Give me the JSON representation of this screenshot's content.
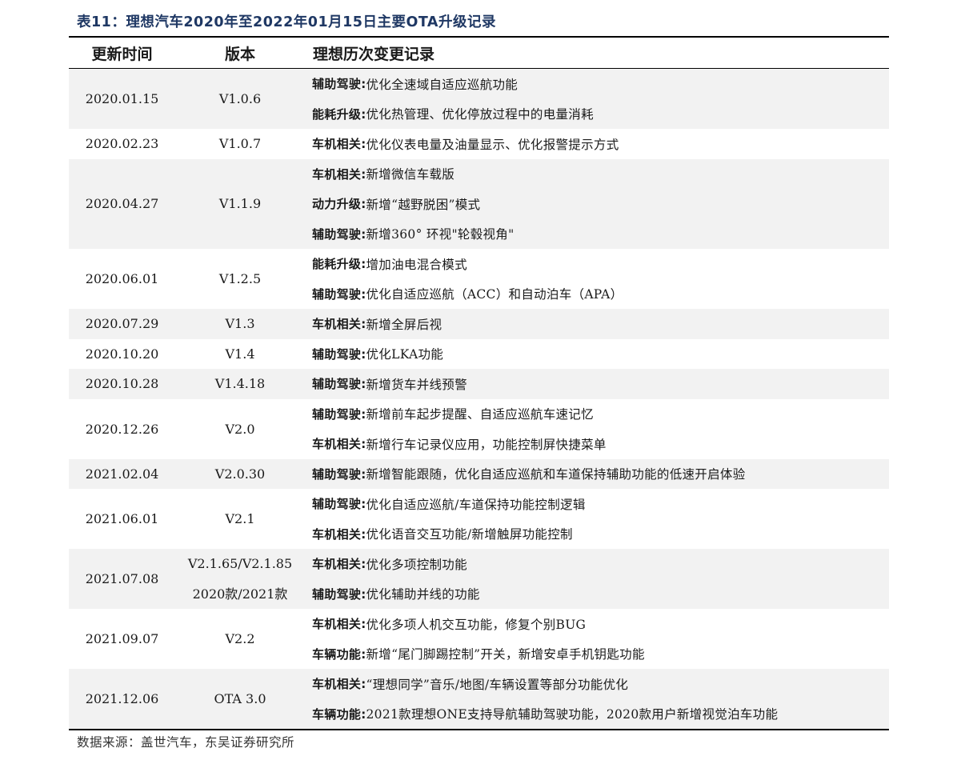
{
  "title": "表11：理想汽车2020年至2022年01月15日主要OTA升级记录",
  "headers": {
    "date": "更新时间",
    "version": "版本",
    "log": "理想历次变更记录"
  },
  "rows": [
    {
      "date": "2020.01.15",
      "version": [
        "V1.0.6"
      ],
      "entries": [
        {
          "cat": "辅助驾驶:",
          "text": "优化全速域自适应巡航功能"
        },
        {
          "cat": "能耗升级:",
          "text": "优化热管理、优化停放过程中的电量消耗"
        }
      ]
    },
    {
      "date": "2020.02.23",
      "version": [
        "V1.0.7"
      ],
      "entries": [
        {
          "cat": "车机相关:",
          "text": "优化仪表电量及油量显示、优化报警提示方式"
        }
      ]
    },
    {
      "date": "2020.04.27",
      "version": [
        "V1.1.9"
      ],
      "entries": [
        {
          "cat": "车机相关:",
          "text": "新增微信车载版"
        },
        {
          "cat": "动力升级:",
          "text": "新增“越野脱困”模式"
        },
        {
          "cat": "辅助驾驶:",
          "text": "新增360° 环视\"轮毂视角\""
        }
      ]
    },
    {
      "date": "2020.06.01",
      "version": [
        "V1.2.5"
      ],
      "entries": [
        {
          "cat": "能耗升级:",
          "text": "增加油电混合模式"
        },
        {
          "cat": "辅助驾驶:",
          "text": "优化自适应巡航（ACC）和自动泊车（APA）"
        }
      ]
    },
    {
      "date": "2020.07.29",
      "version": [
        "V1.3"
      ],
      "entries": [
        {
          "cat": "车机相关:",
          "text": "新增全屏后视"
        }
      ]
    },
    {
      "date": "2020.10.20",
      "version": [
        "V1.4"
      ],
      "entries": [
        {
          "cat": "辅助驾驶:",
          "text": "优化LKA功能"
        }
      ]
    },
    {
      "date": "2020.10.28",
      "version": [
        "V1.4.18"
      ],
      "entries": [
        {
          "cat": "辅助驾驶:",
          "text": "新增货车并线预警"
        }
      ]
    },
    {
      "date": "2020.12.26",
      "version": [
        "V2.0"
      ],
      "entries": [
        {
          "cat": "辅助驾驶:",
          "text": "新增前车起步提醒、自适应巡航车速记忆"
        },
        {
          "cat": "车机相关:",
          "text": "新增行车记录仪应用，功能控制屏快捷菜单"
        }
      ]
    },
    {
      "date": "2021.02.04",
      "version": [
        "V2.0.30"
      ],
      "entries": [
        {
          "cat": "辅助驾驶:",
          "text": "新增智能跟随，优化自适应巡航和车道保持辅助功能的低速开启体验"
        }
      ]
    },
    {
      "date": "2021.06.01",
      "version": [
        "V2.1"
      ],
      "entries": [
        {
          "cat": "辅助驾驶:",
          "text": "优化自适应巡航/车道保持功能控制逻辑"
        },
        {
          "cat": "车机相关:",
          "text": "优化语音交互功能/新增触屏功能控制"
        }
      ]
    },
    {
      "date": "2021.07.08",
      "version": [
        "V2.1.65/V2.1.85",
        "2020款/2021款"
      ],
      "entries": [
        {
          "cat": "车机相关:",
          "text": "优化多项控制功能"
        },
        {
          "cat": "辅助驾驶:",
          "text": "优化辅助并线的功能"
        }
      ]
    },
    {
      "date": "2021.09.07",
      "version": [
        "V2.2"
      ],
      "entries": [
        {
          "cat": "车机相关:",
          "text": "优化多项人机交互功能，修复个别BUG"
        },
        {
          "cat": "车辆功能:",
          "text": "新增“尾门脚踢控制”开关，新增安卓手机钥匙功能"
        }
      ]
    },
    {
      "date": "2021.12.06",
      "version": [
        "OTA 3.0"
      ],
      "entries": [
        {
          "cat": "车机相关:",
          "text": "“理想同学”音乐/地图/车辆设置等部分功能优化"
        },
        {
          "cat": "车辆功能:",
          "text": "2021款理想ONE支持导航辅助驾驶功能，2020款用户新增视觉泊车功能"
        }
      ]
    }
  ],
  "source": "数据来源：盖世汽车，东吴证券研究所"
}
